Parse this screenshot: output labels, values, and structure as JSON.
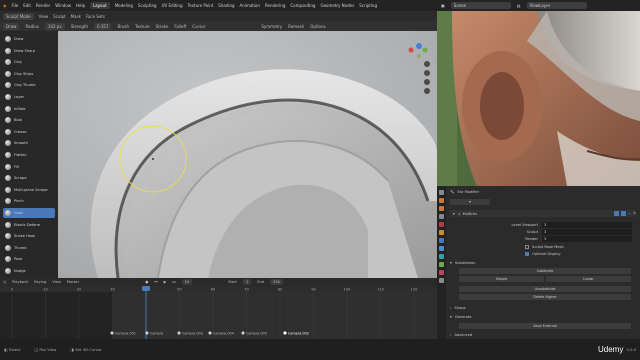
{
  "topbar": {
    "menus": [
      "File",
      "Edit",
      "Render",
      "Window",
      "Help"
    ],
    "workspaces": [
      "Layout",
      "Modeling",
      "Sculpting",
      "UV Editing",
      "Texture Paint",
      "Shading",
      "Animation",
      "Rendering",
      "Compositing",
      "Geometry Nodes",
      "Scripting"
    ],
    "active_workspace": "Layout"
  },
  "right_top": {
    "scene_label": "Scene",
    "viewlayer_label": "ViewLayer"
  },
  "header2": {
    "mode": "Sculpt Mode",
    "items": [
      "View",
      "Sculpt",
      "Mask",
      "Face Sets"
    ]
  },
  "header3": {
    "brush": "Draw",
    "radius_label": "Radius",
    "radius_value": "142 px",
    "strength_label": "Strength",
    "strength_value": "0.357",
    "items": [
      "Brush",
      "Texture",
      "Stroke",
      "Falloff",
      "Cursor"
    ],
    "right_items": [
      "Symmetry",
      "Remesh",
      "Options"
    ]
  },
  "tools": [
    "Draw",
    "Draw Sharp",
    "Clay",
    "Clay Strips",
    "Clay Thumb",
    "Layer",
    "Inflate",
    "Blob",
    "Crease",
    "Smooth",
    "Flatten",
    "Fill",
    "Scrape",
    "Multi-plane Scrape",
    "Pinch",
    "Grab",
    "Elastic Deform",
    "Snake Hook",
    "Thumb",
    "Pose",
    "Nudge"
  ],
  "active_tool": "Grab",
  "timeline": {
    "menus": [
      "Playback",
      "Keying",
      "View",
      "Marker"
    ],
    "start_label": "Start",
    "start_value": "1",
    "end_label": "End",
    "end_value": "250",
    "current_frame": "10",
    "ticks": [
      "0",
      "10",
      "20",
      "30",
      "40",
      "50",
      "60",
      "70",
      "80",
      "90",
      "100",
      "110",
      "120",
      "130"
    ],
    "markers": [
      "Camera.001",
      "Camera",
      "Camera.003",
      "Camera.004",
      "Camera.005",
      "Camera.002"
    ]
  },
  "statusbar": {
    "items": [
      "Select",
      "Pan View",
      "Set 3D Cursor"
    ],
    "version": "3.0.0",
    "watermark": "Udemy"
  },
  "properties": {
    "object_name": "Ear Modifier",
    "modifier_name": "Multires",
    "fields": [
      {
        "label": "Level Viewport",
        "value": "3"
      },
      {
        "label": "Sculpt",
        "value": "3"
      },
      {
        "label": "Render",
        "value": "3"
      }
    ],
    "checkbox_sculpt_base": "Sculpt Base Mesh",
    "checkbox_optimal": "Optimal Display",
    "subdivision_label": "Subdivision",
    "buttons": [
      "Subdivide",
      "Simple",
      "Linear",
      "Unsubdivide",
      "Delete Higher"
    ],
    "sections": [
      "Shape",
      "Generate",
      "Advanced"
    ],
    "save_button": "Save External"
  },
  "colors": {
    "accent": "#4a78b8",
    "panel_bg": "#2b2b2b",
    "viewport_bg": "#b5b7b9",
    "brush_circle": "#e8e04a"
  }
}
